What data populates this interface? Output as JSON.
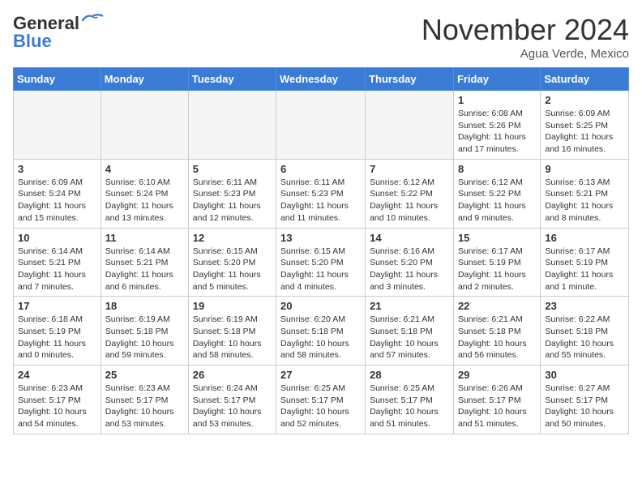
{
  "logo": {
    "line1": "General",
    "line2": "Blue"
  },
  "title": "November 2024",
  "location": "Agua Verde, Mexico",
  "days_header": [
    "Sunday",
    "Monday",
    "Tuesday",
    "Wednesday",
    "Thursday",
    "Friday",
    "Saturday"
  ],
  "weeks": [
    [
      {
        "day": "",
        "info": ""
      },
      {
        "day": "",
        "info": ""
      },
      {
        "day": "",
        "info": ""
      },
      {
        "day": "",
        "info": ""
      },
      {
        "day": "",
        "info": ""
      },
      {
        "day": "1",
        "info": "Sunrise: 6:08 AM\nSunset: 5:26 PM\nDaylight: 11 hours and 17 minutes."
      },
      {
        "day": "2",
        "info": "Sunrise: 6:09 AM\nSunset: 5:25 PM\nDaylight: 11 hours and 16 minutes."
      }
    ],
    [
      {
        "day": "3",
        "info": "Sunrise: 6:09 AM\nSunset: 5:24 PM\nDaylight: 11 hours and 15 minutes."
      },
      {
        "day": "4",
        "info": "Sunrise: 6:10 AM\nSunset: 5:24 PM\nDaylight: 11 hours and 13 minutes."
      },
      {
        "day": "5",
        "info": "Sunrise: 6:11 AM\nSunset: 5:23 PM\nDaylight: 11 hours and 12 minutes."
      },
      {
        "day": "6",
        "info": "Sunrise: 6:11 AM\nSunset: 5:23 PM\nDaylight: 11 hours and 11 minutes."
      },
      {
        "day": "7",
        "info": "Sunrise: 6:12 AM\nSunset: 5:22 PM\nDaylight: 11 hours and 10 minutes."
      },
      {
        "day": "8",
        "info": "Sunrise: 6:12 AM\nSunset: 5:22 PM\nDaylight: 11 hours and 9 minutes."
      },
      {
        "day": "9",
        "info": "Sunrise: 6:13 AM\nSunset: 5:21 PM\nDaylight: 11 hours and 8 minutes."
      }
    ],
    [
      {
        "day": "10",
        "info": "Sunrise: 6:14 AM\nSunset: 5:21 PM\nDaylight: 11 hours and 7 minutes."
      },
      {
        "day": "11",
        "info": "Sunrise: 6:14 AM\nSunset: 5:21 PM\nDaylight: 11 hours and 6 minutes."
      },
      {
        "day": "12",
        "info": "Sunrise: 6:15 AM\nSunset: 5:20 PM\nDaylight: 11 hours and 5 minutes."
      },
      {
        "day": "13",
        "info": "Sunrise: 6:15 AM\nSunset: 5:20 PM\nDaylight: 11 hours and 4 minutes."
      },
      {
        "day": "14",
        "info": "Sunrise: 6:16 AM\nSunset: 5:20 PM\nDaylight: 11 hours and 3 minutes."
      },
      {
        "day": "15",
        "info": "Sunrise: 6:17 AM\nSunset: 5:19 PM\nDaylight: 11 hours and 2 minutes."
      },
      {
        "day": "16",
        "info": "Sunrise: 6:17 AM\nSunset: 5:19 PM\nDaylight: 11 hours and 1 minute."
      }
    ],
    [
      {
        "day": "17",
        "info": "Sunrise: 6:18 AM\nSunset: 5:19 PM\nDaylight: 11 hours and 0 minutes."
      },
      {
        "day": "18",
        "info": "Sunrise: 6:19 AM\nSunset: 5:18 PM\nDaylight: 10 hours and 59 minutes."
      },
      {
        "day": "19",
        "info": "Sunrise: 6:19 AM\nSunset: 5:18 PM\nDaylight: 10 hours and 58 minutes."
      },
      {
        "day": "20",
        "info": "Sunrise: 6:20 AM\nSunset: 5:18 PM\nDaylight: 10 hours and 58 minutes."
      },
      {
        "day": "21",
        "info": "Sunrise: 6:21 AM\nSunset: 5:18 PM\nDaylight: 10 hours and 57 minutes."
      },
      {
        "day": "22",
        "info": "Sunrise: 6:21 AM\nSunset: 5:18 PM\nDaylight: 10 hours and 56 minutes."
      },
      {
        "day": "23",
        "info": "Sunrise: 6:22 AM\nSunset: 5:18 PM\nDaylight: 10 hours and 55 minutes."
      }
    ],
    [
      {
        "day": "24",
        "info": "Sunrise: 6:23 AM\nSunset: 5:17 PM\nDaylight: 10 hours and 54 minutes."
      },
      {
        "day": "25",
        "info": "Sunrise: 6:23 AM\nSunset: 5:17 PM\nDaylight: 10 hours and 53 minutes."
      },
      {
        "day": "26",
        "info": "Sunrise: 6:24 AM\nSunset: 5:17 PM\nDaylight: 10 hours and 53 minutes."
      },
      {
        "day": "27",
        "info": "Sunrise: 6:25 AM\nSunset: 5:17 PM\nDaylight: 10 hours and 52 minutes."
      },
      {
        "day": "28",
        "info": "Sunrise: 6:25 AM\nSunset: 5:17 PM\nDaylight: 10 hours and 51 minutes."
      },
      {
        "day": "29",
        "info": "Sunrise: 6:26 AM\nSunset: 5:17 PM\nDaylight: 10 hours and 51 minutes."
      },
      {
        "day": "30",
        "info": "Sunrise: 6:27 AM\nSunset: 5:17 PM\nDaylight: 10 hours and 50 minutes."
      }
    ]
  ]
}
